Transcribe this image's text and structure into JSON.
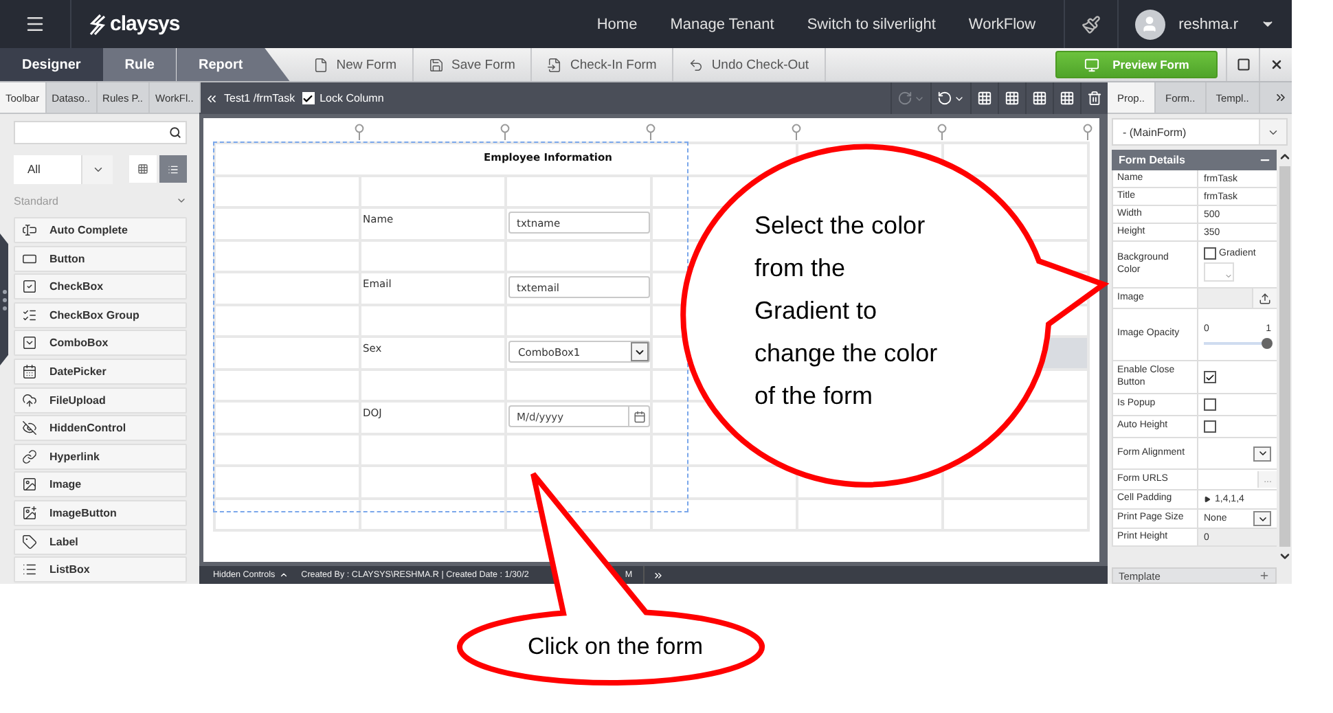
{
  "topbar": {
    "logo": "claysys",
    "nav": [
      "Home",
      "Manage Tenant",
      "Switch to silverlight",
      "WorkFlow"
    ],
    "user": "reshma.r"
  },
  "mode_tabs": [
    {
      "label": "Designer",
      "selected": true
    },
    {
      "label": "Rule",
      "selected": false
    },
    {
      "label": "Report",
      "selected": false
    }
  ],
  "actions": [
    {
      "kind": "new",
      "label": "New Form"
    },
    {
      "kind": "save",
      "label": "Save Form"
    },
    {
      "kind": "checkin",
      "label": "Check-In Form"
    },
    {
      "kind": "undo",
      "label": "Undo Check-Out"
    }
  ],
  "preview_button": "Preview Form",
  "left_panel": {
    "tabs": [
      {
        "label": "Toolbar",
        "selected": true
      },
      {
        "label": "Dataso..",
        "selected": false
      },
      {
        "label": "Rules P..",
        "selected": false
      },
      {
        "label": "WorkFl..",
        "selected": false
      }
    ],
    "filter": "All",
    "views": [
      {
        "kind": "grid",
        "selected": false
      },
      {
        "kind": "list",
        "selected": true
      }
    ],
    "section": "Standard",
    "items": [
      {
        "kind": "autocomplete",
        "label": "Auto Complete"
      },
      {
        "kind": "button",
        "label": "Button"
      },
      {
        "kind": "checkbox",
        "label": "CheckBox"
      },
      {
        "kind": "checkboxgroup",
        "label": "CheckBox Group"
      },
      {
        "kind": "combobox",
        "label": "ComboBox"
      },
      {
        "kind": "datepicker",
        "label": "DatePicker"
      },
      {
        "kind": "fileupload",
        "label": "FileUpload"
      },
      {
        "kind": "hidden",
        "label": "HiddenControl"
      },
      {
        "kind": "hyperlink",
        "label": "Hyperlink"
      },
      {
        "kind": "image",
        "label": "Image"
      },
      {
        "kind": "imagebutton",
        "label": "ImageButton"
      },
      {
        "kind": "label",
        "label": "Label"
      },
      {
        "kind": "listbox",
        "label": "ListBox"
      }
    ]
  },
  "designer": {
    "breadcrumb": "Test1 /frmTask",
    "lock_column": {
      "label": "Lock Column",
      "checked": true
    },
    "tools": [
      {
        "kind": "redo",
        "disabled": true
      },
      {
        "kind": "undo",
        "disabled": false
      },
      {
        "kind": "grid",
        "disabled": false
      },
      {
        "kind": "grid",
        "disabled": false
      },
      {
        "kind": "grid",
        "disabled": false
      },
      {
        "kind": "grid",
        "disabled": false
      },
      {
        "kind": "delete",
        "disabled": false
      }
    ],
    "form": {
      "title": "Employee Information",
      "rows": [
        {
          "kind": "blank",
          "selected": false
        },
        {
          "kind": "field",
          "label": "Name",
          "control": {
            "kind": "textbox",
            "value": "txtname"
          },
          "selected": false
        },
        {
          "kind": "blank",
          "selected": false
        },
        {
          "kind": "field",
          "label": "Email",
          "control": {
            "kind": "textbox",
            "value": "txtemail"
          },
          "selected": false
        },
        {
          "kind": "blank",
          "selected": false
        },
        {
          "kind": "field",
          "label": "Sex",
          "control": {
            "kind": "combobox",
            "value": "ComboBox1"
          },
          "selected": true
        },
        {
          "kind": "blank",
          "selected": false
        },
        {
          "kind": "field",
          "label": "DOJ",
          "control": {
            "kind": "date",
            "placeholder": "M/d/yyyy"
          },
          "selected": false
        },
        {
          "kind": "blank",
          "selected": false
        },
        {
          "kind": "blank",
          "selected": false
        },
        {
          "kind": "blank",
          "selected": false
        }
      ]
    },
    "status": {
      "hidden_controls": "Hidden Controls",
      "created": "Created By : CLAYSYS\\RESHMA.R | Created Date : 1/30/2",
      "created_tail": "M"
    }
  },
  "right_panel": {
    "tabs": [
      {
        "label": "Prop..",
        "selected": true
      },
      {
        "label": "Form..",
        "selected": false
      },
      {
        "label": "Templ..",
        "selected": false
      }
    ],
    "scope": "- (MainForm)",
    "section": "Form Details",
    "properties": [
      {
        "kind": "text",
        "label": "Name",
        "value": "frmTask"
      },
      {
        "kind": "text",
        "label": "Title",
        "value": "frmTask"
      },
      {
        "kind": "text",
        "label": "Width",
        "value": "500"
      },
      {
        "kind": "text",
        "label": "Height",
        "value": "350"
      },
      {
        "kind": "color",
        "label": "Background Color",
        "option": "Gradient",
        "checked": false
      },
      {
        "kind": "upload",
        "label": "Image"
      },
      {
        "kind": "slider",
        "label": "Image Opacity",
        "min": "0",
        "max": "1",
        "level": 1
      },
      {
        "kind": "checkbox",
        "label": "Enable Close Button",
        "checked": true
      },
      {
        "kind": "checkbox",
        "label": "Is Popup",
        "checked": false
      },
      {
        "kind": "checkbox",
        "label": "Auto Height",
        "checked": false
      },
      {
        "kind": "select",
        "label": "Form Alignment"
      },
      {
        "kind": "ellipsis",
        "label": "Form URLS",
        "button": "..."
      },
      {
        "kind": "expand",
        "label": "Cell Padding",
        "value": "1,4,1,4"
      },
      {
        "kind": "select",
        "label": "Print Page Size",
        "value": "None"
      },
      {
        "kind": "readonly",
        "label": "Print Height",
        "value": "0"
      }
    ],
    "next_section": "Template"
  },
  "callouts": [
    {
      "text": "Select the color from the Gradient to change the color of the form"
    },
    {
      "text": "Click on the form"
    }
  ]
}
